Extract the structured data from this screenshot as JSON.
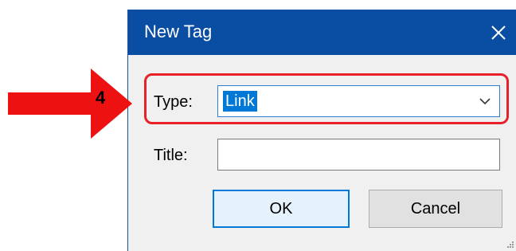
{
  "dialog": {
    "title": "New Tag",
    "close_icon": "close-icon",
    "type_label": "Type:",
    "type_value": "Link",
    "title_label": "Title:",
    "title_value": "",
    "ok_label": "OK",
    "cancel_label": "Cancel"
  },
  "annotation": {
    "step_number": "4",
    "arrow_color": "#ee1111",
    "highlight_color": "#e8202a"
  },
  "colors": {
    "titlebar": "#0a4ea3",
    "selection": "#0078d7",
    "dialog_bg": "#f0f0f0"
  }
}
